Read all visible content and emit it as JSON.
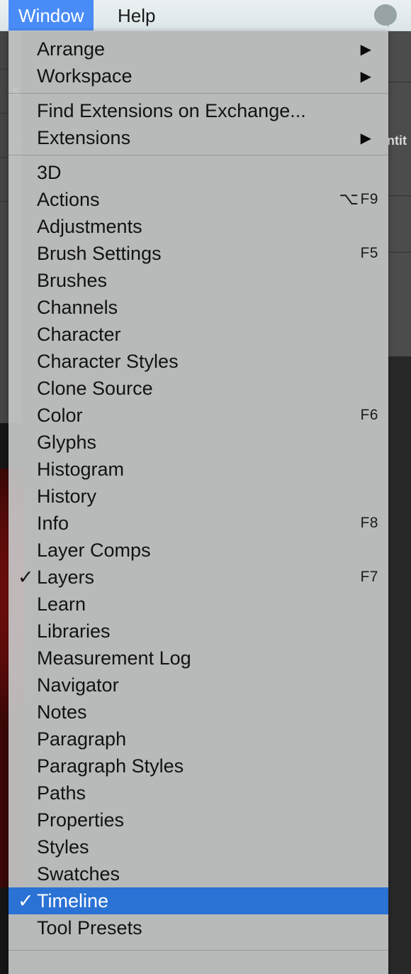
{
  "menubar": {
    "items": [
      {
        "label": "Window",
        "active": true
      },
      {
        "label": "Help",
        "active": false
      }
    ],
    "avatar_icon": "speech-bubble-avatar-icon",
    "accent_color": "#4a8cf7"
  },
  "background_app": {
    "document_tab_label": "ntit",
    "tool_labels": [
      "",
      "s",
      "..",
      ""
    ]
  },
  "menu": {
    "selected_color": "#2a72d4",
    "sections": [
      {
        "items": [
          {
            "label": "Arrange",
            "shortcut": "",
            "submenu": true,
            "checked": false
          },
          {
            "label": "Workspace",
            "shortcut": "",
            "submenu": true,
            "checked": false
          }
        ]
      },
      {
        "items": [
          {
            "label": "Find Extensions on Exchange...",
            "shortcut": "",
            "submenu": false,
            "checked": false
          },
          {
            "label": "Extensions",
            "shortcut": "",
            "submenu": true,
            "checked": false
          }
        ]
      },
      {
        "items": [
          {
            "label": "3D",
            "shortcut": "",
            "submenu": false,
            "checked": false
          },
          {
            "label": "Actions",
            "shortcut": "F9",
            "modifier": "⌥",
            "submenu": false,
            "checked": false
          },
          {
            "label": "Adjustments",
            "shortcut": "",
            "submenu": false,
            "checked": false
          },
          {
            "label": "Brush Settings",
            "shortcut": "F5",
            "submenu": false,
            "checked": false
          },
          {
            "label": "Brushes",
            "shortcut": "",
            "submenu": false,
            "checked": false
          },
          {
            "label": "Channels",
            "shortcut": "",
            "submenu": false,
            "checked": false
          },
          {
            "label": "Character",
            "shortcut": "",
            "submenu": false,
            "checked": false
          },
          {
            "label": "Character Styles",
            "shortcut": "",
            "submenu": false,
            "checked": false
          },
          {
            "label": "Clone Source",
            "shortcut": "",
            "submenu": false,
            "checked": false
          },
          {
            "label": "Color",
            "shortcut": "F6",
            "submenu": false,
            "checked": false
          },
          {
            "label": "Glyphs",
            "shortcut": "",
            "submenu": false,
            "checked": false
          },
          {
            "label": "Histogram",
            "shortcut": "",
            "submenu": false,
            "checked": false
          },
          {
            "label": "History",
            "shortcut": "",
            "submenu": false,
            "checked": false
          },
          {
            "label": "Info",
            "shortcut": "F8",
            "submenu": false,
            "checked": false
          },
          {
            "label": "Layer Comps",
            "shortcut": "",
            "submenu": false,
            "checked": false
          },
          {
            "label": "Layers",
            "shortcut": "F7",
            "submenu": false,
            "checked": true
          },
          {
            "label": "Learn",
            "shortcut": "",
            "submenu": false,
            "checked": false
          },
          {
            "label": "Libraries",
            "shortcut": "",
            "submenu": false,
            "checked": false
          },
          {
            "label": "Measurement Log",
            "shortcut": "",
            "submenu": false,
            "checked": false
          },
          {
            "label": "Navigator",
            "shortcut": "",
            "submenu": false,
            "checked": false
          },
          {
            "label": "Notes",
            "shortcut": "",
            "submenu": false,
            "checked": false
          },
          {
            "label": "Paragraph",
            "shortcut": "",
            "submenu": false,
            "checked": false
          },
          {
            "label": "Paragraph Styles",
            "shortcut": "",
            "submenu": false,
            "checked": false
          },
          {
            "label": "Paths",
            "shortcut": "",
            "submenu": false,
            "checked": false
          },
          {
            "label": "Properties",
            "shortcut": "",
            "submenu": false,
            "checked": false
          },
          {
            "label": "Styles",
            "shortcut": "",
            "submenu": false,
            "checked": false
          },
          {
            "label": "Swatches",
            "shortcut": "",
            "submenu": false,
            "checked": false
          },
          {
            "label": "Timeline",
            "shortcut": "",
            "submenu": false,
            "checked": true,
            "selected": true
          },
          {
            "label": "Tool Presets",
            "shortcut": "",
            "submenu": false,
            "checked": false
          }
        ]
      }
    ],
    "checkmark_glyph": "✓",
    "submenu_glyph": "▶"
  }
}
